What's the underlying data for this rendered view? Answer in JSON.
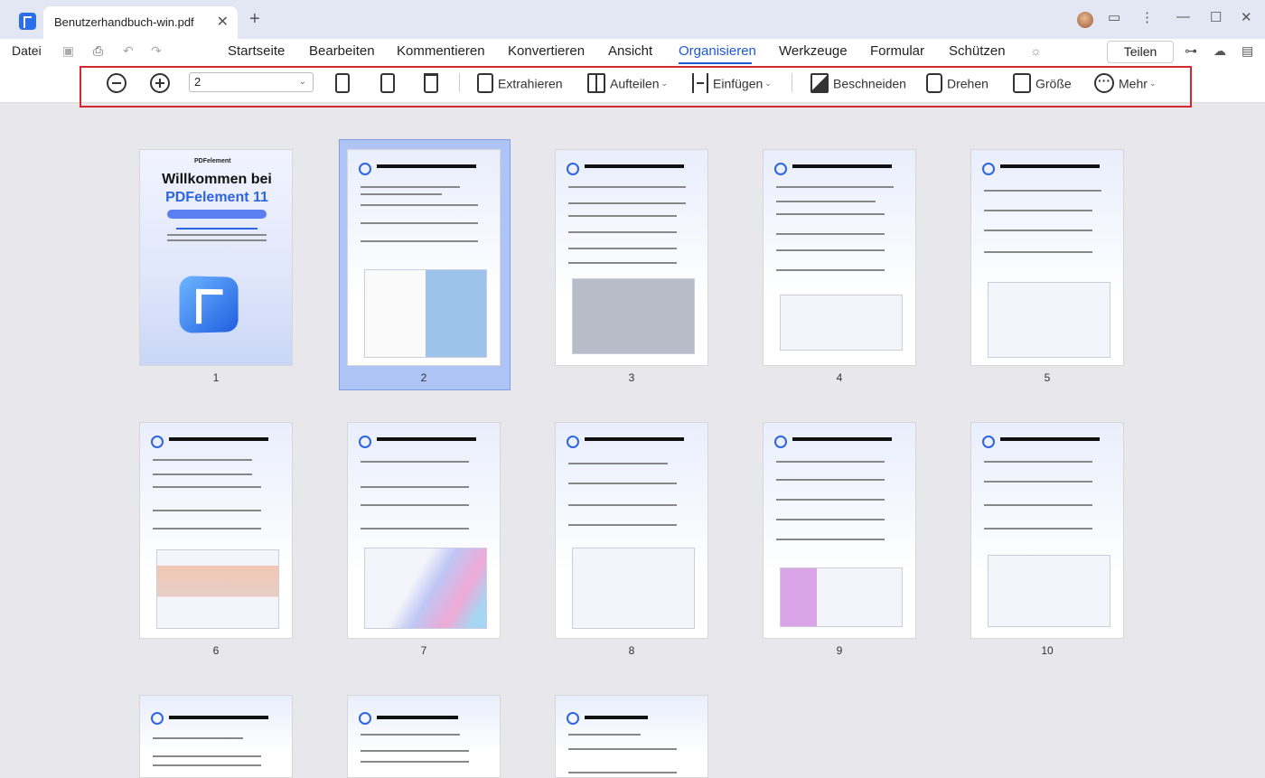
{
  "window": {
    "tab_title": "Benutzerhandbuch-win.pdf",
    "tab_close": "✕",
    "new_tab": "+"
  },
  "menu": {
    "file": "Datei",
    "items": [
      "Startseite",
      "Bearbeiten",
      "Kommentieren",
      "Konvertieren",
      "Ansicht",
      "Organisieren",
      "Werkzeuge",
      "Formular",
      "Schützen"
    ],
    "active": "Organisieren",
    "share": "Teilen"
  },
  "toolbar": {
    "page_value": "2",
    "extract": "Extrahieren",
    "split": "Aufteilen",
    "insert": "Einfügen",
    "crop": "Beschneiden",
    "rotate": "Drehen",
    "size": "Größe",
    "more": "Mehr"
  },
  "cover": {
    "title_line1": "Willkommen bei",
    "title_line2": "PDFelement 11",
    "brand": "PDFelement"
  },
  "pages": [
    {
      "num": "1"
    },
    {
      "num": "2",
      "selected": true
    },
    {
      "num": "3"
    },
    {
      "num": "4"
    },
    {
      "num": "5"
    },
    {
      "num": "6"
    },
    {
      "num": "7"
    },
    {
      "num": "8"
    },
    {
      "num": "9"
    },
    {
      "num": "10"
    },
    {
      "num": ""
    },
    {
      "num": ""
    },
    {
      "num": ""
    }
  ],
  "colors": {
    "accent": "#1e58d8",
    "highlight": "#d6262e",
    "selected": "#aec4f5"
  }
}
